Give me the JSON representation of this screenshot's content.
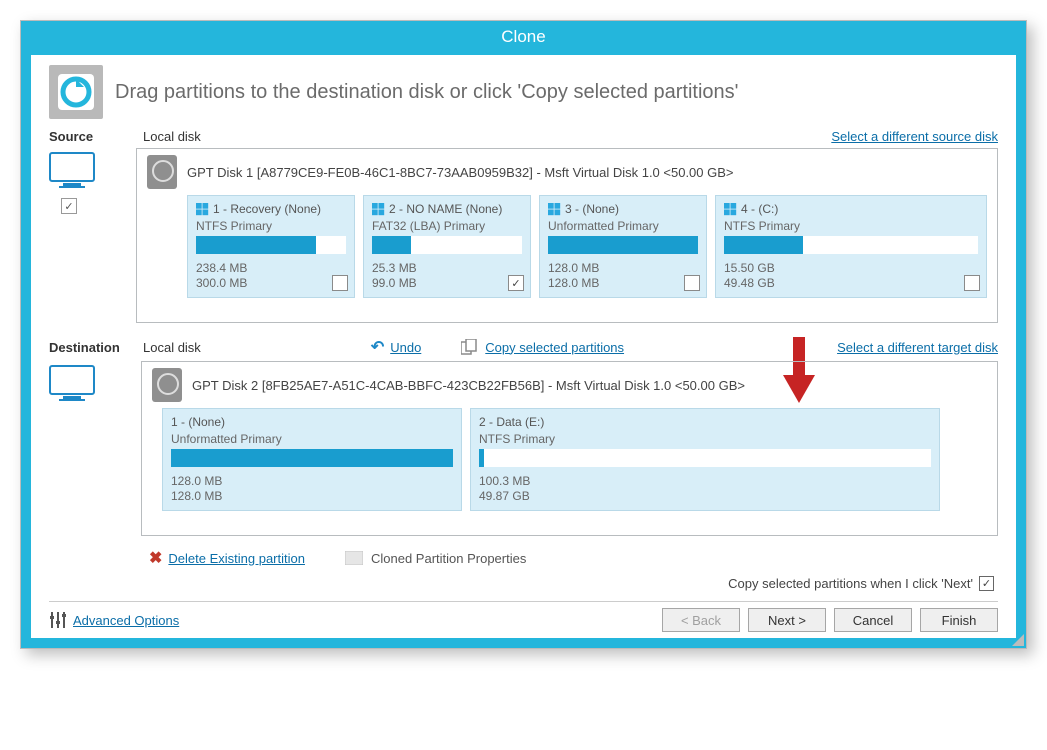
{
  "title": "Clone",
  "hero": "Drag partitions to the destination disk or click 'Copy selected partitions'",
  "source": {
    "label": "Source",
    "scope": "Local disk",
    "select_link": "Select a different source disk",
    "selected_checked": "✓",
    "disk_header": "GPT Disk 1 [A8779CE9-FE0B-46C1-8BC7-73AAB0959B32] - Msft      Virtual Disk      1.0  <50.00 GB>",
    "parts": [
      {
        "title": "1 - Recovery (None)",
        "sub": "NTFS Primary",
        "size1": "238.4 MB",
        "size2": "300.0 MB",
        "fill": 80,
        "checked": ""
      },
      {
        "title": "2 - NO NAME (None)",
        "sub": "FAT32 (LBA) Primary",
        "size1": "25.3 MB",
        "size2": "99.0 MB",
        "fill": 26,
        "checked": "✓"
      },
      {
        "title": "3 -   (None)",
        "sub": "Unformatted Primary",
        "size1": "128.0 MB",
        "size2": "128.0 MB",
        "fill": 100,
        "checked": ""
      },
      {
        "title": "4 -   (C:)",
        "sub": "NTFS Primary",
        "size1": "15.50 GB",
        "size2": "49.48 GB",
        "fill": 31,
        "checked": ""
      }
    ]
  },
  "destination": {
    "label": "Destination",
    "scope": "Local disk",
    "undo": "Undo",
    "copy_sel": "Copy selected partitions",
    "select_link": "Select a different target disk",
    "disk_header": "GPT Disk 2 [8FB25AE7-A51C-4CAB-BBFC-423CB22FB56B] - Msft      Virtual Disk      1.0  <50.00 GB>",
    "parts": [
      {
        "title": "1 -   (None)",
        "sub": "Unformatted Primary",
        "size1": "128.0 MB",
        "size2": "128.0 MB",
        "fill": 100
      },
      {
        "title": "2 - Data (E:)",
        "sub": "NTFS Primary",
        "size1": "100.3 MB",
        "size2": "49.87 GB",
        "fill": 1
      }
    ]
  },
  "actions": {
    "delete": "Delete Existing partition",
    "cloned_props": "Cloned Partition Properties"
  },
  "copy_note": "Copy selected partitions when I click 'Next'",
  "copy_note_checked": "✓",
  "footer": {
    "advanced": "Advanced Options",
    "back": "< Back",
    "next": "Next >",
    "cancel": "Cancel",
    "finish": "Finish"
  }
}
